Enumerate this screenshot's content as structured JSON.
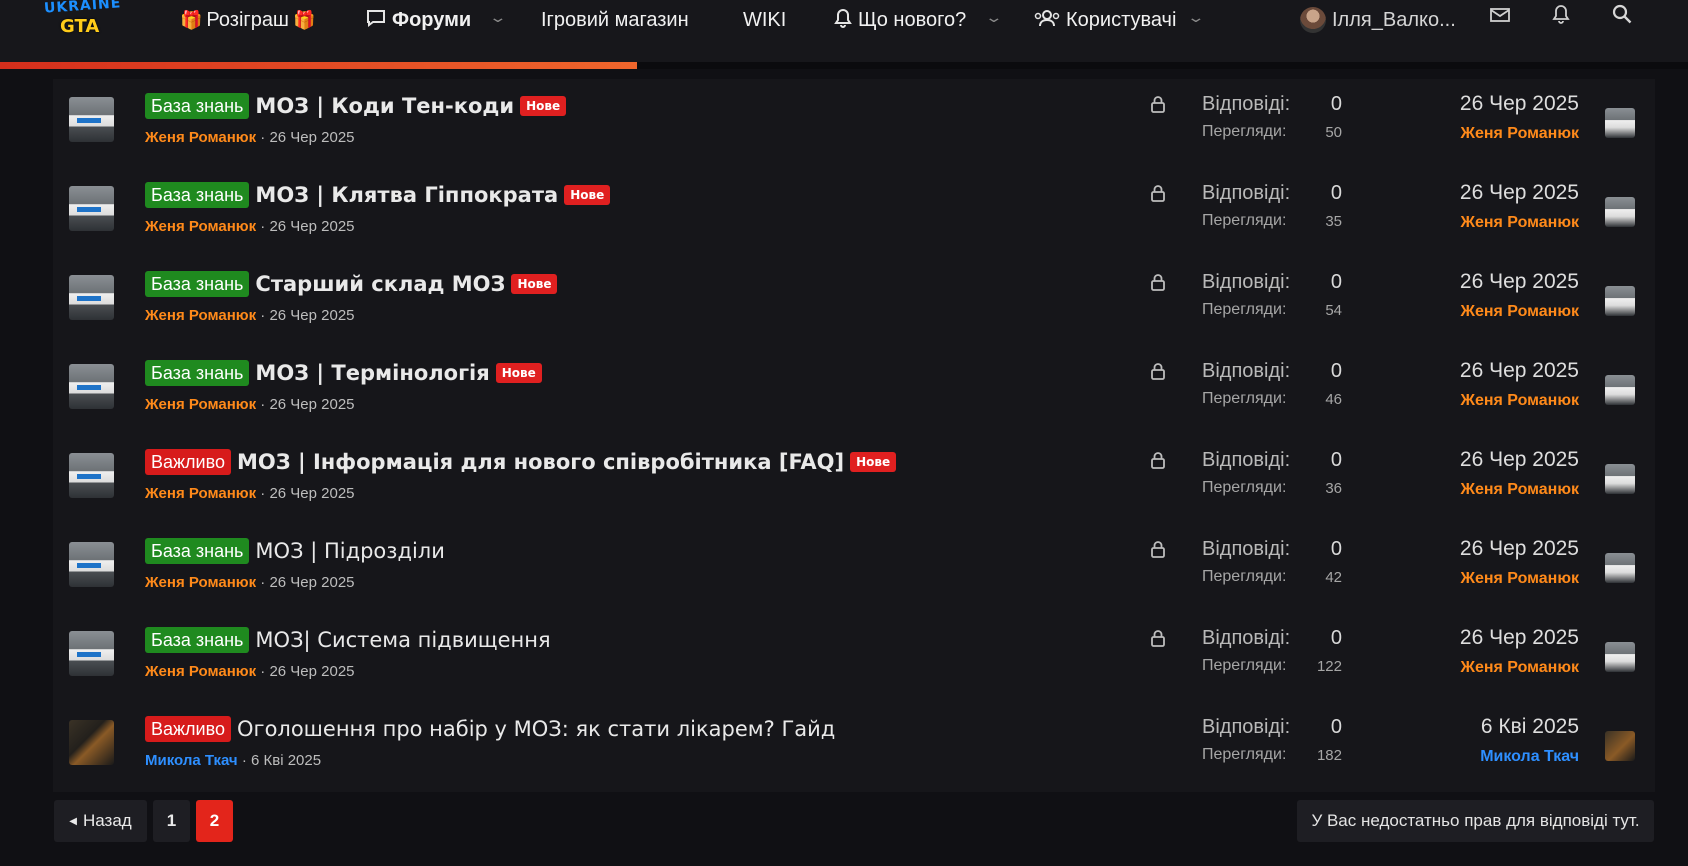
{
  "nav": {
    "logo_top": "UKRAINE",
    "logo_bottom": "GTA",
    "giveaway": "Розіграш",
    "forums": "Форуми",
    "store": "Ігровий магазин",
    "wiki": "WIKI",
    "whats_new": "Що нового?",
    "users": "Користувачі",
    "username": "Ілля_Валко...",
    "colors": {
      "progress": "#e3361d",
      "gift": "#f7b020"
    }
  },
  "threads": [
    {
      "prefix": "База знань",
      "prefix_color": "green",
      "title": "МОЗ | Коди Тен-коди",
      "bold": true,
      "new_badge": "Нове",
      "author": "Женя Романюк",
      "author_color": "#ff8a1a",
      "date": "26 Чер 2025",
      "locked": true,
      "replies_label": "Відповіді:",
      "replies": "0",
      "views_label": "Перегляди:",
      "views": "50",
      "last_date": "26 Чер 2025",
      "last_user": "Женя Романюк",
      "last_user_color": "#ff8a1a"
    },
    {
      "prefix": "База знань",
      "prefix_color": "green",
      "title": "МОЗ | Клятва Гіппократа",
      "bold": true,
      "new_badge": "Нове",
      "author": "Женя Романюк",
      "author_color": "#ff8a1a",
      "date": "26 Чер 2025",
      "locked": true,
      "replies_label": "Відповіді:",
      "replies": "0",
      "views_label": "Перегляди:",
      "views": "35",
      "last_date": "26 Чер 2025",
      "last_user": "Женя Романюк",
      "last_user_color": "#ff8a1a"
    },
    {
      "prefix": "База знань",
      "prefix_color": "green",
      "title": "Старший склад МОЗ",
      "bold": true,
      "new_badge": "Нове",
      "author": "Женя Романюк",
      "author_color": "#ff8a1a",
      "date": "26 Чер 2025",
      "locked": true,
      "replies_label": "Відповіді:",
      "replies": "0",
      "views_label": "Перегляди:",
      "views": "54",
      "last_date": "26 Чер 2025",
      "last_user": "Женя Романюк",
      "last_user_color": "#ff8a1a"
    },
    {
      "prefix": "База знань",
      "prefix_color": "green",
      "title": "МОЗ | Термінологія",
      "bold": true,
      "new_badge": "Нове",
      "author": "Женя Романюк",
      "author_color": "#ff8a1a",
      "date": "26 Чер 2025",
      "locked": true,
      "replies_label": "Відповіді:",
      "replies": "0",
      "views_label": "Перегляди:",
      "views": "46",
      "last_date": "26 Чер 2025",
      "last_user": "Женя Романюк",
      "last_user_color": "#ff8a1a"
    },
    {
      "prefix": "Важливо",
      "prefix_color": "red",
      "title": "МОЗ | Інформація для нового співробітника [FAQ]",
      "bold": true,
      "new_badge": "Нове",
      "author": "Женя Романюк",
      "author_color": "#ff8a1a",
      "date": "26 Чер 2025",
      "locked": true,
      "replies_label": "Відповіді:",
      "replies": "0",
      "views_label": "Перегляди:",
      "views": "36",
      "last_date": "26 Чер 2025",
      "last_user": "Женя Романюк",
      "last_user_color": "#ff8a1a"
    },
    {
      "prefix": "База знань",
      "prefix_color": "green",
      "title": "МОЗ | Підрозділи",
      "bold": false,
      "new_badge": "",
      "author": "Женя Романюк",
      "author_color": "#ff8a1a",
      "date": "26 Чер 2025",
      "locked": true,
      "replies_label": "Відповіді:",
      "replies": "0",
      "views_label": "Перегляди:",
      "views": "42",
      "last_date": "26 Чер 2025",
      "last_user": "Женя Романюк",
      "last_user_color": "#ff8a1a"
    },
    {
      "prefix": "База знань",
      "prefix_color": "green",
      "title": "МОЗ| Система підвищення",
      "bold": false,
      "new_badge": "",
      "author": "Женя Романюк",
      "author_color": "#ff8a1a",
      "date": "26 Чер 2025",
      "locked": true,
      "replies_label": "Відповіді:",
      "replies": "0",
      "views_label": "Перегляди:",
      "views": "122",
      "last_date": "26 Чер 2025",
      "last_user": "Женя Романюк",
      "last_user_color": "#ff8a1a"
    },
    {
      "prefix": "Важливо",
      "prefix_color": "red",
      "title": "Оголошення про набір у МОЗ: як стати лікарем? Гайд",
      "bold": false,
      "new_badge": "",
      "author": "Микола Ткач",
      "author_color": "#2e8fff",
      "date": "6 Кві 2025",
      "locked": false,
      "replies_label": "Відповіді:",
      "replies": "0",
      "views_label": "Перегляди:",
      "views": "182",
      "last_date": "6 Кві 2025",
      "last_user": "Микола Ткач",
      "last_user_color": "#2e8fff"
    }
  ],
  "pagination": {
    "back_label": "Назад",
    "pages": [
      "1",
      "2"
    ],
    "current_page": "2"
  },
  "no_rights_text": "У Вас недостатньо прав для відповіді тут."
}
